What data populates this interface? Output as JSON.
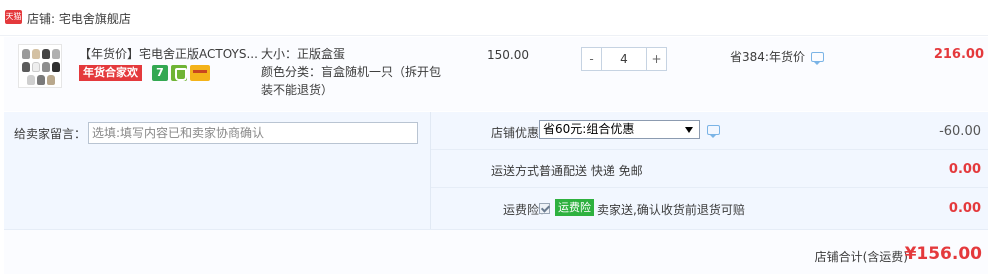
{
  "shop": {
    "badge_text": "天猫",
    "label_prefix": "店铺: ",
    "name": "宅电舍旗舰店"
  },
  "item": {
    "thumbnail_alt": "product-thumbnail",
    "title": "【年货价】宅电舍正版ACTOYS...",
    "promo_tag": "年货合家欢",
    "seven_day_icon_text": "7",
    "sku_size": "大小：正版盒蛋",
    "sku_color_line1": "颜色分类：盲盒随机一只（拆开包",
    "sku_color_line2": "装不能退货）",
    "unit_price": "150.00",
    "qty_minus": "-",
    "quantity": "4",
    "qty_plus": "+",
    "discount_text": "省384:年货价",
    "subtotal": "216.00"
  },
  "message": {
    "label": "给卖家留言：",
    "placeholder": "选填:填写内容已和卖家协商确认"
  },
  "options": {
    "coupon_label": "店铺优惠：",
    "coupon_selected": "省60元:组合优惠",
    "coupon_value": "-60.00",
    "shipping_label": "运送方式：",
    "shipping_text": "普通配送 快递 免邮",
    "shipping_value": "0.00",
    "insurance_label": "运费险：",
    "insurance_tag": "运费险",
    "insurance_text": "卖家送,确认收货前退货可赔",
    "insurance_value": "0.00"
  },
  "total": {
    "label": "店铺合计(含运费)",
    "value": "¥156.00"
  },
  "colors": {
    "price_red": "#e4393c",
    "tag_green": "#2eb13f",
    "panel_bg": "#f2f7ff"
  },
  "icons": [
    "tmall-icon",
    "seven-day-return-icon",
    "guarantee-icon",
    "card-icon",
    "chat-icon",
    "check-icon",
    "dropdown-arrow-icon"
  ]
}
